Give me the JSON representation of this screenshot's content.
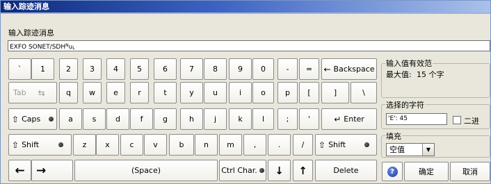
{
  "window": {
    "title": "输入踪迹消息"
  },
  "prompt": "输入踪迹消息",
  "input": {
    "prefix": "EXFO SONET/SDH",
    "sup": "N",
    "mid": "u",
    "sub": "L"
  },
  "keys": {
    "row1": [
      "`",
      "1",
      "2",
      "3",
      "4",
      "5",
      "6",
      "7",
      "8",
      "9",
      "0",
      "-",
      "="
    ],
    "backspace": "Backspace",
    "tab": "Tab",
    "row2": [
      "q",
      "w",
      "e",
      "r",
      "t",
      "y",
      "u",
      "i",
      "o",
      "p",
      "[",
      "]",
      "\\"
    ],
    "caps": "Caps",
    "row3": [
      "a",
      "s",
      "d",
      "f",
      "g",
      "h",
      "j",
      "k",
      "l",
      ";",
      "'"
    ],
    "enter": "Enter",
    "shift": "Shift",
    "row4": [
      "z",
      "x",
      "c",
      "v",
      "b",
      "n",
      "m",
      ",",
      ".",
      "/"
    ],
    "space": "(Space)",
    "ctrl": "Ctrl Char.",
    "delete": "Delete"
  },
  "valid_range": {
    "title": "输入值有效范",
    "max_label": "最大值:",
    "max_value": "15 个字"
  },
  "selected_char": {
    "title": "选择的字符",
    "value": "'E': 45",
    "binary_label": "二进"
  },
  "fill": {
    "title": "填充",
    "selected": "空值"
  },
  "buttons": {
    "ok": "确定",
    "cancel": "取消"
  }
}
